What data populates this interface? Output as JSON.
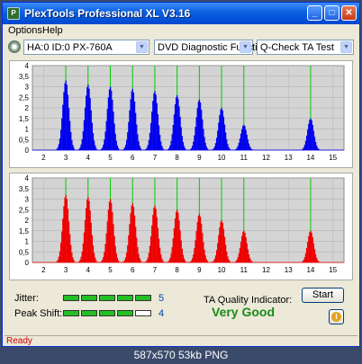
{
  "window": {
    "title": "PlexTools Professional XL V3.16"
  },
  "menu": [
    "Options",
    "Help"
  ],
  "toolbar": {
    "drive": "HA:0 ID:0  PX-760A",
    "mode": "DVD Diagnostic Functions",
    "test": "Q-Check TA Test"
  },
  "metrics": {
    "jitter_label": "Jitter:",
    "jitter_value": "5",
    "peak_label": "Peak Shift:",
    "peak_value": "4",
    "quality_label": "TA Quality Indicator:",
    "quality_value": "Very Good"
  },
  "buttons": {
    "start": "Start",
    "info": "i"
  },
  "status": "Ready",
  "caption": "587x570  53kb  PNG",
  "colors": {
    "top": "#0000ee",
    "bottom": "#ee0000",
    "greenline": "#00cc00"
  },
  "chart_data": [
    {
      "type": "bar",
      "series": [
        {
          "name": "",
          "color": "#0000ee"
        }
      ],
      "x_ticks": [
        "2",
        "3",
        "4",
        "5",
        "6",
        "7",
        "8",
        "9",
        "10",
        "11",
        "12",
        "13",
        "14",
        "15"
      ],
      "y_ticks": [
        "0",
        "0,5",
        "1",
        "1,5",
        "2",
        "2,5",
        "3",
        "3,5",
        "4"
      ],
      "ylim": [
        0,
        4
      ],
      "xlim": [
        1.5,
        15.5
      ],
      "peaks": [
        {
          "x": 3,
          "y": 3.3
        },
        {
          "x": 4,
          "y": 3.1
        },
        {
          "x": 5,
          "y": 3.0
        },
        {
          "x": 6,
          "y": 2.9
        },
        {
          "x": 7,
          "y": 2.8
        },
        {
          "x": 8,
          "y": 2.6
        },
        {
          "x": 9,
          "y": 2.4
        },
        {
          "x": 10,
          "y": 2.0
        },
        {
          "x": 11,
          "y": 1.2
        },
        {
          "x": 14,
          "y": 1.5
        }
      ],
      "reference_lines_x": [
        3,
        4,
        5,
        6,
        7,
        8,
        9,
        10,
        11,
        14
      ]
    },
    {
      "type": "bar",
      "series": [
        {
          "name": "",
          "color": "#ee0000"
        }
      ],
      "x_ticks": [
        "2",
        "3",
        "4",
        "5",
        "6",
        "7",
        "8",
        "9",
        "10",
        "11",
        "12",
        "13",
        "14",
        "15"
      ],
      "y_ticks": [
        "0",
        "0,5",
        "1",
        "1,5",
        "2",
        "2,5",
        "3",
        "3,5",
        "4"
      ],
      "ylim": [
        0,
        4
      ],
      "xlim": [
        1.5,
        15.5
      ],
      "peaks": [
        {
          "x": 3,
          "y": 3.2
        },
        {
          "x": 4,
          "y": 3.1
        },
        {
          "x": 5,
          "y": 3.0
        },
        {
          "x": 6,
          "y": 2.8
        },
        {
          "x": 7,
          "y": 2.7
        },
        {
          "x": 8,
          "y": 2.5
        },
        {
          "x": 9,
          "y": 2.3
        },
        {
          "x": 10,
          "y": 2.0
        },
        {
          "x": 11,
          "y": 1.5
        },
        {
          "x": 14,
          "y": 1.5
        }
      ],
      "reference_lines_x": [
        3,
        4,
        5,
        6,
        7,
        8,
        9,
        10,
        11,
        14
      ]
    }
  ]
}
